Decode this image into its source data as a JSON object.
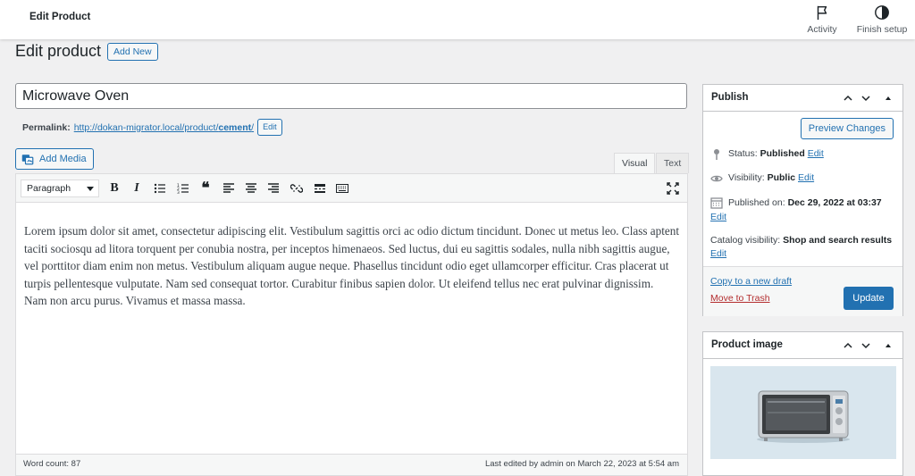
{
  "topbar": {
    "title": "Edit Product",
    "activity_label": "Activity",
    "finish_label": "Finish setup"
  },
  "heading": {
    "title": "Edit product",
    "add_new_label": "Add New"
  },
  "product": {
    "title": "Microwave Oven"
  },
  "permalink": {
    "label": "Permalink:",
    "url_base": "http://dokan-migrator.local/product/",
    "slug": "cement",
    "url_end": "/",
    "edit_label": "Edit"
  },
  "editor": {
    "add_media_label": "Add Media",
    "tab_visual": "Visual",
    "tab_text": "Text",
    "format_select": "Paragraph",
    "toolbar_icons": [
      "bold-icon",
      "italic-icon",
      "bullet-list-icon",
      "numbered-list-icon",
      "blockquote-icon",
      "align-left-icon",
      "align-center-icon",
      "align-right-icon",
      "link-icon",
      "read-more-icon",
      "toolbar-toggle-icon",
      "fullscreen-icon"
    ],
    "content": "Lorem ipsum dolor sit amet, consectetur adipiscing elit. Vestibulum sagittis orci ac odio dictum tincidunt. Donec ut metus leo. Class aptent taciti sociosqu ad litora torquent per conubia nostra, per inceptos himenaeos. Sed luctus, dui eu sagittis sodales, nulla nibh sagittis augue, vel porttitor diam enim non metus. Vestibulum aliquam augue neque. Phasellus tincidunt odio eget ullamcorper efficitur. Cras placerat ut turpis pellentesque vulputate. Nam sed consequat tortor. Curabitur finibus sapien dolor. Ut eleifend tellus nec erat pulvinar dignissim. Nam non arcu purus. Vivamus et massa massa.",
    "word_count": "Word count: 87",
    "last_edited": "Last edited by admin on March 22, 2023 at 5:54 am"
  },
  "publish": {
    "title": "Publish",
    "preview_label": "Preview Changes",
    "status_label": "Status:",
    "status_value": "Published",
    "visibility_label": "Visibility:",
    "visibility_value": "Public",
    "published_label": "Published on:",
    "published_value": "Dec 29, 2022 at 03:37",
    "catalog_label": "Catalog visibility:",
    "catalog_value": "Shop and search results",
    "edit_label": "Edit",
    "copy_draft_label": "Copy to a new draft",
    "trash_label": "Move to Trash",
    "update_label": "Update"
  },
  "product_image": {
    "title": "Product image"
  },
  "colors": {
    "accent": "#2271b1",
    "danger": "#b32d2e",
    "background": "#f0f0f1"
  }
}
